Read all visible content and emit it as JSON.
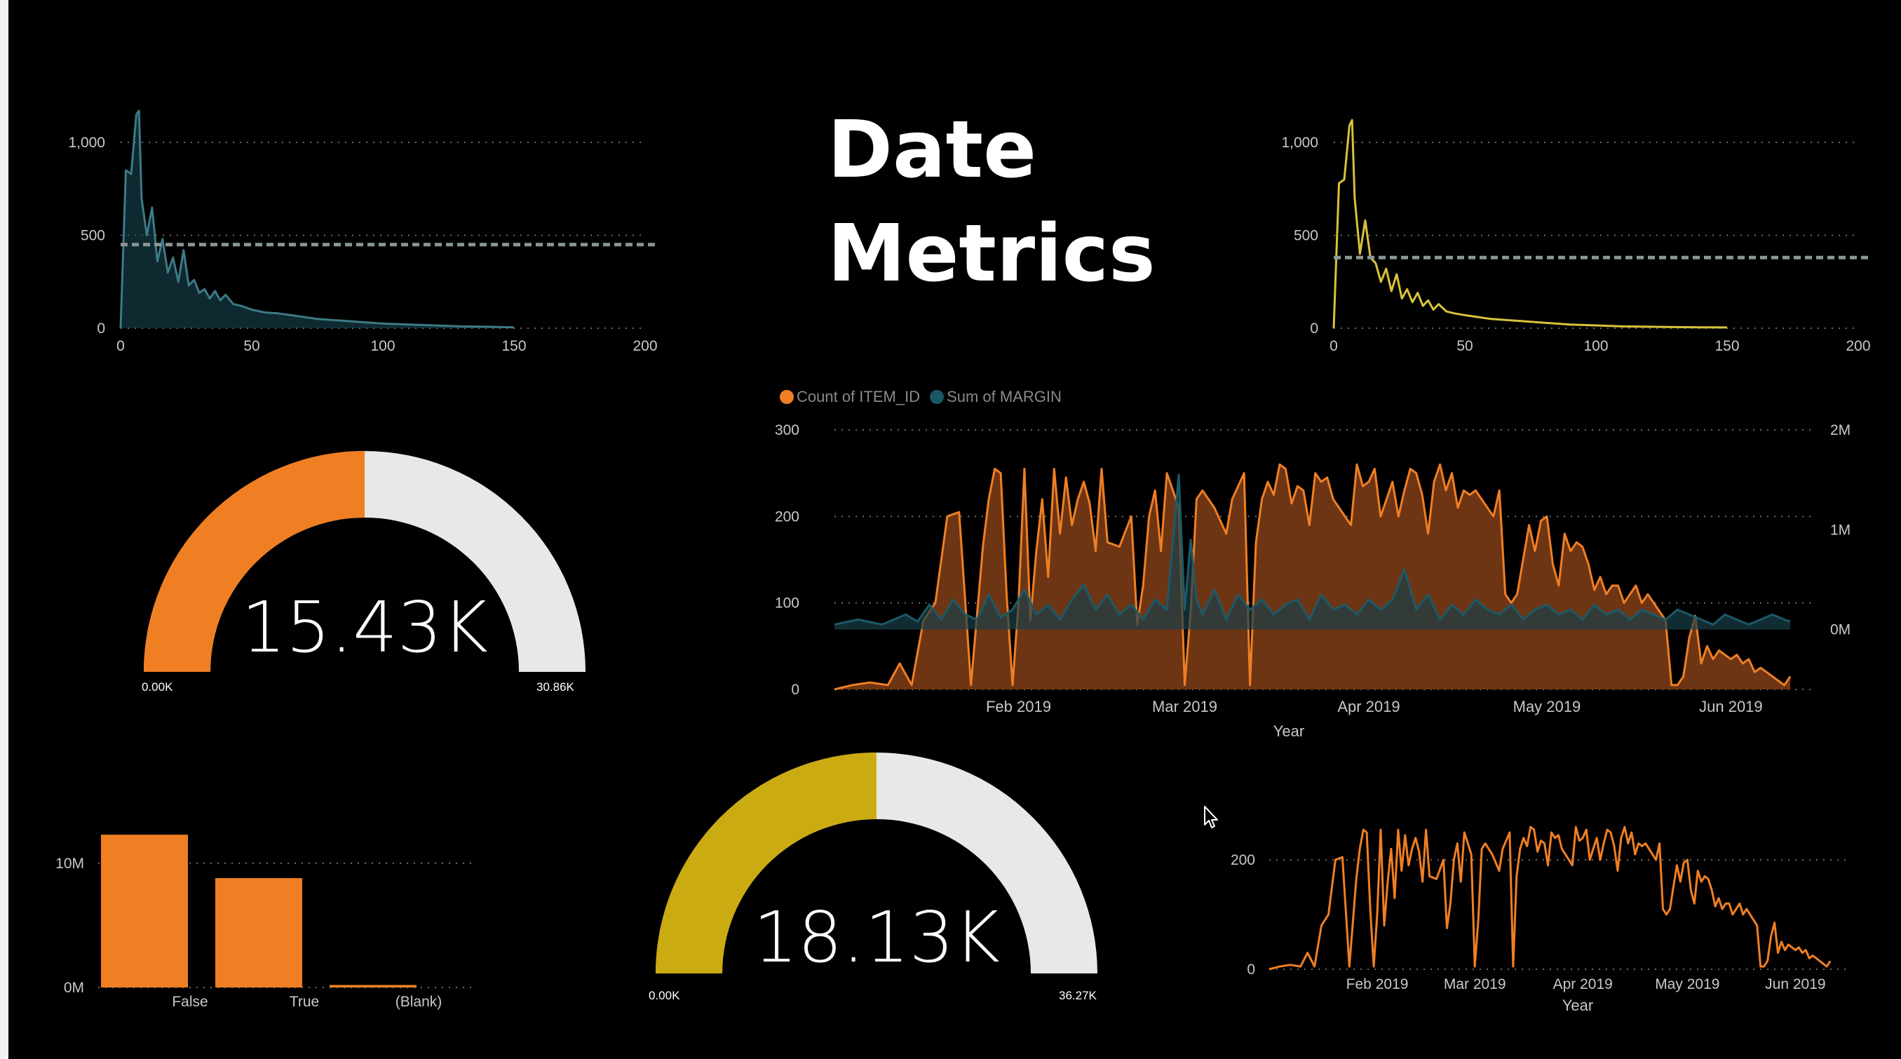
{
  "title": {
    "line1": "Date",
    "line2": "Metrics"
  },
  "colors": {
    "orange": "#f07f24",
    "teal": "#1a4a57",
    "teal_line": "#3d7a86",
    "yellow": "#d9c33a",
    "gold": "#cbab12",
    "gauge_track": "#e8e8e8",
    "gridline": "#6b6b6b",
    "reference_line": "#8a9696"
  },
  "chart_data": [
    {
      "id": "histogram_teal",
      "type": "area",
      "x": [
        0,
        2,
        4,
        6,
        7,
        8,
        10,
        12,
        14,
        16,
        18,
        20,
        22,
        24,
        26,
        28,
        30,
        32,
        34,
        36,
        38,
        40,
        43,
        46,
        50,
        55,
        60,
        65,
        70,
        75,
        80,
        85,
        90,
        100,
        110,
        120,
        130,
        140,
        150
      ],
      "y": [
        0,
        850,
        830,
        1150,
        1170,
        700,
        500,
        650,
        360,
        480,
        300,
        380,
        250,
        420,
        230,
        260,
        190,
        210,
        160,
        200,
        150,
        180,
        130,
        120,
        100,
        85,
        80,
        70,
        60,
        50,
        45,
        40,
        35,
        25,
        20,
        15,
        10,
        8,
        5
      ],
      "reference_line": 450,
      "xlim": [
        0,
        200
      ],
      "ylim": [
        0,
        1200
      ],
      "x_ticks": [
        "0",
        "50",
        "100",
        "150",
        "200"
      ],
      "y_ticks": [
        "0",
        "500",
        "1,000"
      ],
      "title": "",
      "xlabel": "",
      "ylabel": ""
    },
    {
      "id": "histogram_yellow",
      "type": "line",
      "x": [
        0,
        2,
        4,
        6,
        7,
        8,
        10,
        12,
        14,
        16,
        18,
        20,
        22,
        24,
        26,
        28,
        30,
        32,
        34,
        36,
        38,
        40,
        43,
        46,
        50,
        55,
        60,
        65,
        70,
        75,
        80,
        85,
        90,
        100,
        110,
        120,
        130,
        140,
        150
      ],
      "y": [
        0,
        780,
        800,
        1090,
        1120,
        700,
        400,
        580,
        380,
        350,
        250,
        320,
        200,
        290,
        160,
        210,
        140,
        190,
        120,
        150,
        100,
        130,
        90,
        80,
        70,
        60,
        50,
        45,
        40,
        35,
        30,
        25,
        20,
        15,
        10,
        8,
        6,
        5,
        4
      ],
      "reference_line": 380,
      "xlim": [
        0,
        200
      ],
      "ylim": [
        0,
        1200
      ],
      "x_ticks": [
        "0",
        "50",
        "100",
        "150",
        "200"
      ],
      "y_ticks": [
        "0",
        "500",
        "1,000"
      ],
      "title": "",
      "xlabel": "",
      "ylabel": ""
    },
    {
      "id": "combo_timeseries",
      "type": "area",
      "title": "",
      "xlabel": "Year",
      "x_ticks": [
        "Feb 2019",
        "Mar 2019",
        "Apr 2019",
        "May 2019",
        "Jun 2019"
      ],
      "x_tick_days": [
        31,
        59,
        90,
        120,
        151
      ],
      "y_ticks_left": [
        "0",
        "100",
        "200",
        "300"
      ],
      "y_ticks_right": [
        "0M",
        "1M",
        "2M"
      ],
      "ylim_left": [
        0,
        300
      ],
      "ylim_right": [
        -0.6,
        2.0
      ],
      "x_days_range": [
        0,
        163
      ],
      "series": [
        {
          "name": "Count of ITEM_ID",
          "axis": "left",
          "x_days": [
            0,
            3,
            6,
            9,
            11,
            13,
            15,
            17,
            19,
            21,
            23,
            25,
            26,
            27,
            28,
            29,
            30,
            31,
            32,
            33,
            34,
            35,
            36,
            37,
            38,
            39,
            40,
            41,
            42,
            43,
            44,
            45,
            46,
            48,
            50,
            51,
            52,
            53,
            54,
            55,
            56,
            57,
            58,
            59,
            60,
            61,
            62,
            64,
            66,
            67,
            68,
            69,
            70,
            71,
            72,
            73,
            74,
            75,
            76,
            77,
            78,
            79,
            80,
            81,
            82,
            83,
            84,
            85,
            86,
            87,
            88,
            89,
            90,
            91,
            92,
            93,
            94,
            95,
            96,
            97,
            98,
            99,
            100,
            101,
            102,
            103,
            104,
            105,
            106,
            107,
            108,
            109,
            110,
            111,
            112,
            113,
            114,
            115,
            116,
            117,
            118,
            119,
            120,
            121,
            122,
            123,
            124,
            125,
            126,
            127,
            128,
            129,
            130,
            131,
            132,
            133,
            134,
            135,
            136,
            137,
            138,
            139,
            140,
            141,
            142,
            143,
            144,
            145,
            146,
            147,
            148,
            149,
            150,
            151,
            152,
            153,
            154,
            155,
            156,
            157,
            158,
            159,
            160,
            161
          ],
          "y": [
            0,
            5,
            8,
            5,
            30,
            5,
            80,
            100,
            200,
            205,
            5,
            165,
            220,
            255,
            250,
            110,
            5,
            100,
            255,
            80,
            160,
            220,
            130,
            255,
            180,
            245,
            190,
            220,
            240,
            215,
            160,
            255,
            170,
            165,
            200,
            75,
            120,
            200,
            230,
            160,
            250,
            230,
            210,
            5,
            90,
            220,
            230,
            210,
            180,
            220,
            235,
            250,
            5,
            170,
            220,
            240,
            225,
            260,
            255,
            215,
            235,
            230,
            190,
            250,
            240,
            245,
            220,
            210,
            200,
            190,
            260,
            235,
            240,
            255,
            200,
            220,
            240,
            200,
            230,
            255,
            250,
            225,
            180,
            240,
            260,
            230,
            250,
            210,
            230,
            225,
            230,
            220,
            210,
            200,
            230,
            110,
            100,
            110,
            150,
            190,
            160,
            195,
            200,
            145,
            120,
            180,
            160,
            170,
            165,
            145,
            115,
            130,
            110,
            120,
            120,
            100,
            110,
            120,
            100,
            110,
            100,
            90,
            80,
            5,
            5,
            15,
            60,
            85,
            30,
            50,
            35,
            45,
            40,
            35,
            40,
            30,
            35,
            20,
            25,
            20,
            15,
            10,
            5,
            15,
            5,
            20
          ],
          "color": "#f07f24"
        },
        {
          "name": "Sum of MARGIN",
          "axis": "right",
          "x_days": [
            0,
            4,
            8,
            12,
            14,
            16,
            18,
            20,
            22,
            24,
            26,
            28,
            30,
            32,
            34,
            36,
            38,
            40,
            42,
            44,
            46,
            48,
            50,
            52,
            54,
            56,
            58,
            59,
            60,
            61,
            62,
            64,
            66,
            68,
            70,
            72,
            74,
            76,
            78,
            80,
            82,
            84,
            86,
            88,
            90,
            92,
            94,
            96,
            98,
            100,
            102,
            104,
            106,
            108,
            110,
            112,
            114,
            116,
            118,
            120,
            122,
            124,
            126,
            128,
            130,
            132,
            134,
            136,
            138,
            140,
            142,
            144,
            146,
            148,
            150,
            152,
            154,
            156,
            158,
            160,
            161
          ],
          "y": [
            0.05,
            0.1,
            0.05,
            0.15,
            0.08,
            0.25,
            0.1,
            0.3,
            0.15,
            0.1,
            0.35,
            0.12,
            0.2,
            0.4,
            0.15,
            0.25,
            0.1,
            0.3,
            0.45,
            0.2,
            0.35,
            0.15,
            0.25,
            0.1,
            0.3,
            0.2,
            1.55,
            0.2,
            0.9,
            0.3,
            0.15,
            0.4,
            0.1,
            0.35,
            0.2,
            0.3,
            0.15,
            0.25,
            0.3,
            0.1,
            0.35,
            0.2,
            0.25,
            0.15,
            0.3,
            0.2,
            0.3,
            0.6,
            0.2,
            0.35,
            0.1,
            0.25,
            0.15,
            0.3,
            0.2,
            0.15,
            0.25,
            0.1,
            0.2,
            0.25,
            0.15,
            0.2,
            0.1,
            0.25,
            0.15,
            0.2,
            0.1,
            0.2,
            0.15,
            0.1,
            0.2,
            0.15,
            0.1,
            0.05,
            0.15,
            0.1,
            0.05,
            0.1,
            0.15,
            0.1,
            0.08
          ],
          "color": "#1a4a57"
        }
      ]
    },
    {
      "id": "gauge_orange",
      "type": "gauge",
      "value": 15.43,
      "min": 0,
      "max": 30.86,
      "value_label": "15.43K",
      "min_label": "0.00K",
      "max_label": "30.86K",
      "color": "#f07f24"
    },
    {
      "id": "gauge_yellow",
      "type": "gauge",
      "value": 18.13,
      "min": 0,
      "max": 36.27,
      "value_label": "18.13K",
      "min_label": "0.00K",
      "max_label": "36.27K",
      "color": "#cbab12"
    },
    {
      "id": "bar_false_true",
      "type": "bar",
      "categories": [
        "False",
        "True",
        "(Blank)"
      ],
      "values": [
        12.3,
        8.8,
        0.2
      ],
      "ylim": [
        0,
        14
      ],
      "y_ticks": [
        "0M",
        "10M"
      ],
      "y_tick_values": [
        0,
        10
      ],
      "title": "",
      "xlabel": "",
      "ylabel": "",
      "color": "#f07f24"
    },
    {
      "id": "line_small_orange",
      "type": "line",
      "xlabel": "Year",
      "x_ticks": [
        "Feb 2019",
        "Mar 2019",
        "Apr 2019",
        "May 2019",
        "Jun 2019"
      ],
      "x_tick_days": [
        31,
        59,
        90,
        120,
        151
      ],
      "y_ticks": [
        "0",
        "200"
      ],
      "y_tick_values": [
        0,
        200
      ],
      "ylim": [
        0,
        300
      ],
      "x_days_range": [
        0,
        163
      ],
      "title": "",
      "color": "#f07f24"
    }
  ]
}
